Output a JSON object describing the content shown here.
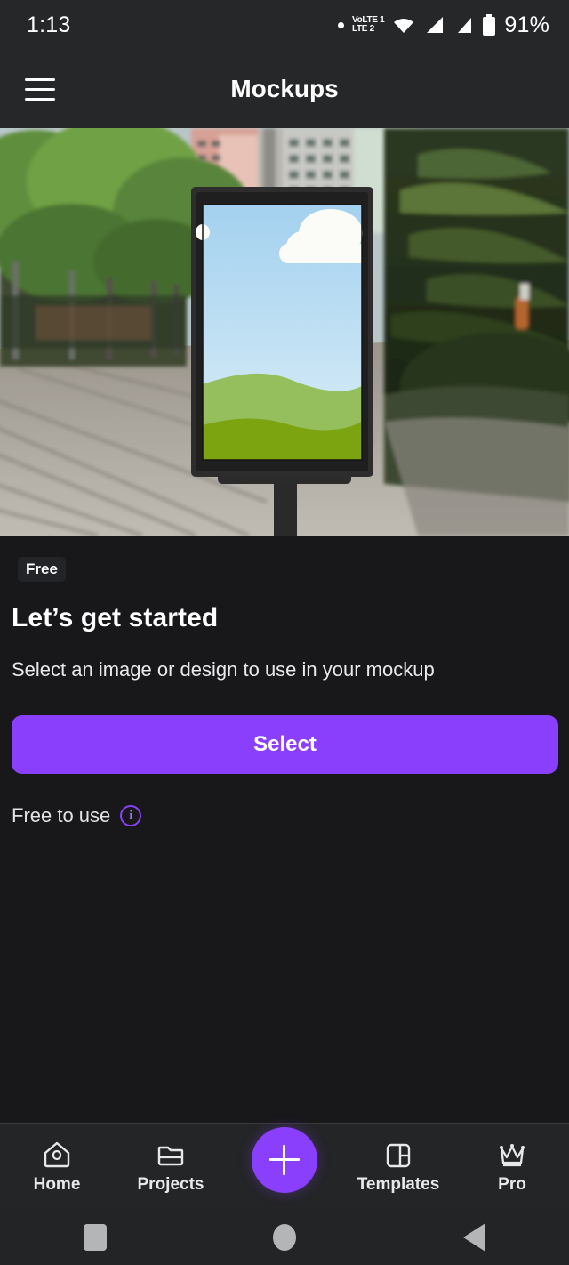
{
  "statusbar": {
    "time": "1:13",
    "battery_percent": "91%",
    "network_line1": "VoLTE 1",
    "network_line2": "LTE 2",
    "icons": [
      "recording-dot",
      "volte-icon",
      "wifi-icon",
      "signal-icon-1",
      "signal-icon-2",
      "battery-icon"
    ]
  },
  "appbar": {
    "menu_icon": "hamburger-menu-icon",
    "title": "Mockups"
  },
  "hero": {
    "alt": "billboard-mockup-street-scene",
    "billboard_placeholder": {
      "sky_top": "#a7d3f0",
      "sky_bottom": "#d8ecf7",
      "cloud": "#fbfbf7",
      "hill_light": "#95bf5c",
      "hill_dark": "#7ba410"
    }
  },
  "main": {
    "badge": "Free",
    "headline": "Let’s get started",
    "subtext": "Select an image or design to use in your mockup",
    "select_label": "Select",
    "free_to_use_label": "Free to use",
    "info_glyph": "i"
  },
  "bottomnav": {
    "items": [
      {
        "label": "Home",
        "icon": "home-icon"
      },
      {
        "label": "Projects",
        "icon": "folder-icon"
      },
      {
        "label": "Templates",
        "icon": "layout-panel-icon"
      },
      {
        "label": "Pro",
        "icon": "crown-icon"
      }
    ],
    "fab_icon": "plus-icon"
  },
  "sysnav": {
    "recents": "square-recents-icon",
    "home": "circle-home-icon",
    "back": "triangle-back-icon"
  },
  "colors": {
    "accent": "#8a3ffc",
    "background": "#18181a",
    "surface": "#262729",
    "text_primary": "#ffffff",
    "text_secondary": "#e3e3e4"
  }
}
